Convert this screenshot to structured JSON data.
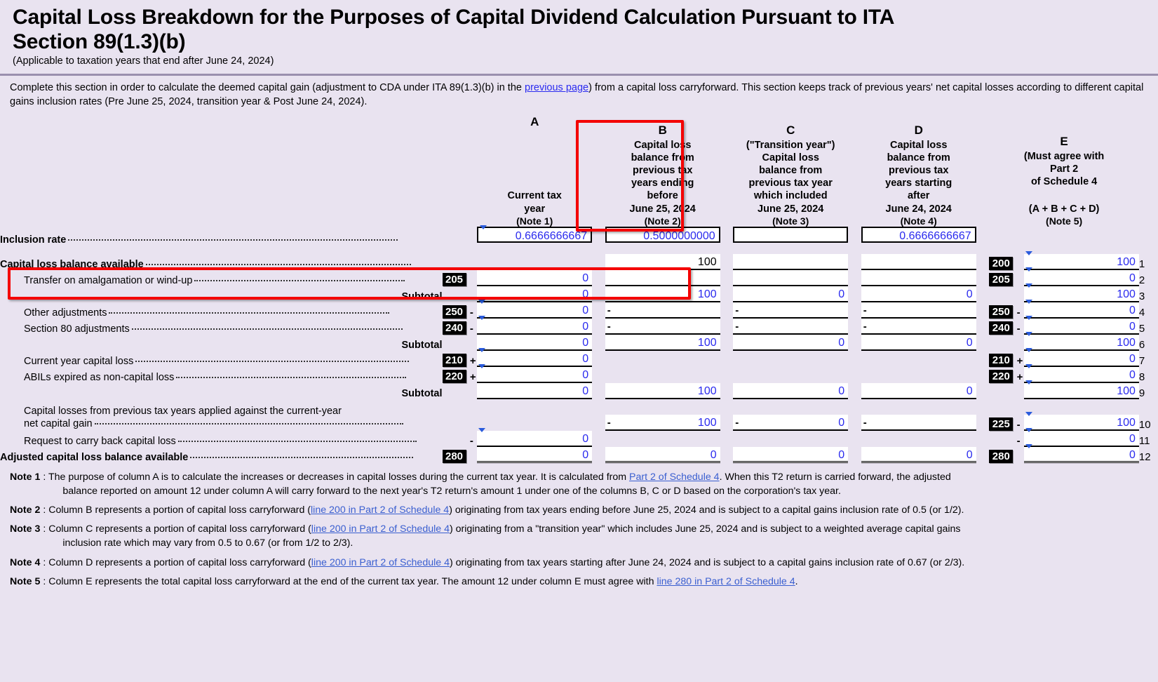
{
  "header": {
    "title": "Capital Loss Breakdown for the Purposes of Capital Dividend Calculation Pursuant to ITA Section 89(1.3)(b)",
    "subtitle": "(Applicable to taxation years that end after June 24, 2024)"
  },
  "intro": {
    "part1": "Complete this section in order to calculate the deemed capital gain (adjustment to CDA under ITA 89(1.3)(b) in the ",
    "link": "previous page",
    "part2": ") from a capital loss carryforward. This section keeps track of previous years' net capital losses according to different capital gains inclusion rates (Pre June 25, 2024, transition year & Post June 24, 2024)."
  },
  "columns": [
    {
      "letter": "A",
      "title": "Current tax\nyear",
      "note": "(Note 1)"
    },
    {
      "letter": "B",
      "title": "Capital loss\nbalance from\nprevious tax\nyears ending\nbefore\nJune 25, 2024",
      "note": "(Note 2)"
    },
    {
      "letter": "C",
      "title": "(\"Transition year\")\nCapital loss\nbalance from\nprevious tax year\nwhich included\nJune 25, 2024",
      "note": "(Note 3)"
    },
    {
      "letter": "D",
      "title": "Capital loss\nbalance from\nprevious tax\nyears starting\nafter\nJune 24, 2024",
      "note": "(Note 4)"
    },
    {
      "letter": "E",
      "title": "(Must agree with\nPart 2\nof Schedule 4)\n\n(A + B + C + D)",
      "note": "(Note 5)"
    }
  ],
  "colhead": {
    "A_letter": "A",
    "A_l1": "Current tax",
    "A_l2": "year",
    "A_note": "(Note 1)",
    "B_letter": "B",
    "B_l1": "Capital loss",
    "B_l2": "balance from",
    "B_l3": "previous tax",
    "B_l4": "years ending",
    "B_l5": "before",
    "B_l6": "June 25, 2024",
    "B_note": "(Note 2)",
    "C_letter": "C",
    "C_l1": "(\"Transition year\")",
    "C_l2": "Capital loss",
    "C_l3": "balance from",
    "C_l4": "previous tax year",
    "C_l5": "which included",
    "C_l6": "June 25, 2024",
    "C_note": "(Note 3)",
    "D_letter": "D",
    "D_l1": "Capital loss",
    "D_l2": "balance from",
    "D_l3": "previous tax",
    "D_l4": "years starting",
    "D_l5": "after",
    "D_l6": "June 24, 2024",
    "D_note": "(Note 4)",
    "E_letter": "E",
    "E_l1": "(Must agree with",
    "E_l2": "Part 2",
    "E_l3": "of Schedule 4",
    "E_l4": "(A + B + C + D)",
    "E_note": "(Note 5)"
  },
  "rows": {
    "inclusion": {
      "label": "Inclusion rate",
      "A": "0.6666666667",
      "B": "0.5000000000",
      "C": "",
      "D": "0.6666666667",
      "E": ""
    },
    "r1": {
      "label": "Capital loss balance available",
      "A": "",
      "B": "100",
      "C": "",
      "D": "",
      "E": "100",
      "E_line": "200",
      "idx": "1"
    },
    "r2": {
      "label": "Transfer on amalgamation or wind-up",
      "A_line": "205",
      "A": "0",
      "B": "",
      "C": "",
      "D": "",
      "E": "0",
      "E_line": "205",
      "idx": "2"
    },
    "r3": {
      "label": "Subtotal",
      "A": "0",
      "B": "100",
      "C": "0",
      "D": "0",
      "E": "100",
      "idx": "3"
    },
    "r4": {
      "label": "Other adjustments",
      "A_line": "250",
      "A": "0",
      "B": "",
      "C": "",
      "D": "",
      "E": "0",
      "E_line": "250",
      "sign": "-",
      "idx": "4"
    },
    "r5": {
      "label": "Section 80 adjustments",
      "A_line": "240",
      "A": "0",
      "B": "",
      "C": "",
      "D": "",
      "E": "0",
      "E_line": "240",
      "sign": "-",
      "idx": "5"
    },
    "r6": {
      "label": "Subtotal",
      "A": "0",
      "B": "100",
      "C": "0",
      "D": "0",
      "E": "100",
      "idx": "6"
    },
    "r7": {
      "label": "Current year capital loss",
      "A_line": "210",
      "A": "0",
      "B": "",
      "C": "",
      "D": "",
      "E": "0",
      "E_line": "210",
      "sign": "+",
      "idx": "7"
    },
    "r8": {
      "label": "ABILs expired as non-capital loss",
      "A_line": "220",
      "A": "0",
      "B": "",
      "C": "",
      "D": "",
      "E": "0",
      "E_line": "220",
      "sign": "+",
      "idx": "8"
    },
    "r9": {
      "label": "Subtotal",
      "A": "0",
      "B": "100",
      "C": "0",
      "D": "0",
      "E": "100",
      "idx": "9"
    },
    "r10": {
      "label_l1": "Capital losses from previous tax years applied against the current-year",
      "label_l2": "net capital gain",
      "A": "",
      "B": "100",
      "C": "0",
      "D": "",
      "E": "100",
      "E_line": "225",
      "sign": "-",
      "idx": "10"
    },
    "r11": {
      "label": "Request to carry back capital loss",
      "A": "0",
      "B": "",
      "C": "",
      "D": "",
      "E": "0",
      "sign": "-",
      "idx": "11"
    },
    "r12": {
      "label": "Adjusted capital loss balance available",
      "A_line": "280",
      "A": "0",
      "B": "0",
      "C": "0",
      "D": "0",
      "E": "0",
      "E_line": "280",
      "idx": "12"
    }
  },
  "notes": [
    {
      "tag": "Note 1",
      "t1": ": The purpose of column A is to calculate the increases or decreases in capital losses during the current tax year. It is calculated from ",
      "link": "Part 2 of Schedule 4",
      "t2": ". When this T2 return is carried forward, the adjusted balance reported on amount 12 under column A will carry forward to the next year's T2 return's amount 1 under one of the columns B, C or D based on the corporation's tax year."
    },
    {
      "tag": "Note 2",
      "t1": ": Column B represents a portion of capital loss carryforward (",
      "link": "line 200 in Part 2 of Schedule 4",
      "t2": ") originating from tax years ending before June 25, 2024 and is subject to a capital gains inclusion rate of 0.5 (or 1/2)."
    },
    {
      "tag": "Note 3",
      "t1": ": Column C represents a portion of capital loss carryforward (",
      "link": "line 200 in Part 2 of Schedule 4",
      "t2": ") originating from a \"transition year\" which includes June 25, 2024 and is subject to a weighted average capital gains inclusion rate which may vary from 0.5 to 0.67 (or from 1/2 to 2/3)."
    },
    {
      "tag": "Note 4",
      "t1": ": Column D represents a portion of capital loss carryforward (",
      "link": "line 200 in Part 2 of Schedule 4",
      "t2": ") originating from tax years starting after June 24, 2024 and is subject to a capital gains inclusion rate of 0.67 (or 2/3)."
    },
    {
      "tag": "Note 5",
      "t1": ": Column E represents the total capital loss carryforward at the end of the current tax year. The amount 12 under column E must agree with ",
      "link": "line 280 in Part 2 of Schedule 4",
      "t2": "."
    }
  ],
  "notes_flat": {
    "n1_tag": "Note 1",
    "n1_a": ": The purpose of column A is to calculate the increases or decreases in capital losses during the current tax year. It is calculated from ",
    "n1_link": "Part 2 of Schedule 4",
    "n1_b": ". When this T2 return is carried forward, the adjusted",
    "n1_c": "balance reported on amount 12 under column A will carry forward to the next year's T2 return's amount 1 under one of the columns B, C or D based on the corporation's tax year.",
    "n2_tag": "Note 2",
    "n2_a": ": Column B represents a portion of capital loss carryforward (",
    "n2_link": "line 200 in Part 2 of Schedule 4",
    "n2_b": ") originating from tax years ending before June 25, 2024 and is subject to a capital gains inclusion rate of 0.5 (or 1/2).",
    "n3_tag": "Note 3",
    "n3_a": ": Column C represents a portion of capital loss carryforward (",
    "n3_link": "line 200 in Part 2 of Schedule 4",
    "n3_b": ") originating from a \"transition year\" which includes June 25, 2024 and is subject to a weighted average capital gains",
    "n3_c": "inclusion rate which may vary from 0.5 to 0.67 (or from 1/2 to 2/3).",
    "n4_tag": "Note 4",
    "n4_a": ": Column D represents a portion of capital loss carryforward (",
    "n4_link": "line 200 in Part 2 of Schedule 4",
    "n4_b": ") originating from tax years starting after June 24, 2024 and is subject to a capital gains inclusion rate of 0.67 (or 2/3).",
    "n5_tag": "Note 5",
    "n5_a": ": Column E represents the total capital loss carryforward at the end of the current tax year. The amount 12 under column E must agree with ",
    "n5_link": "line 280 in Part 2 of Schedule 4",
    "n5_b": "."
  },
  "colors": {
    "page_bg": "#e9e3f0",
    "value_blue": "#2a2aee",
    "link_blue": "#2b2bf0",
    "note_link": "#3a5fd0",
    "highlight_red": "#f40000",
    "rule": "#9a8fae"
  }
}
